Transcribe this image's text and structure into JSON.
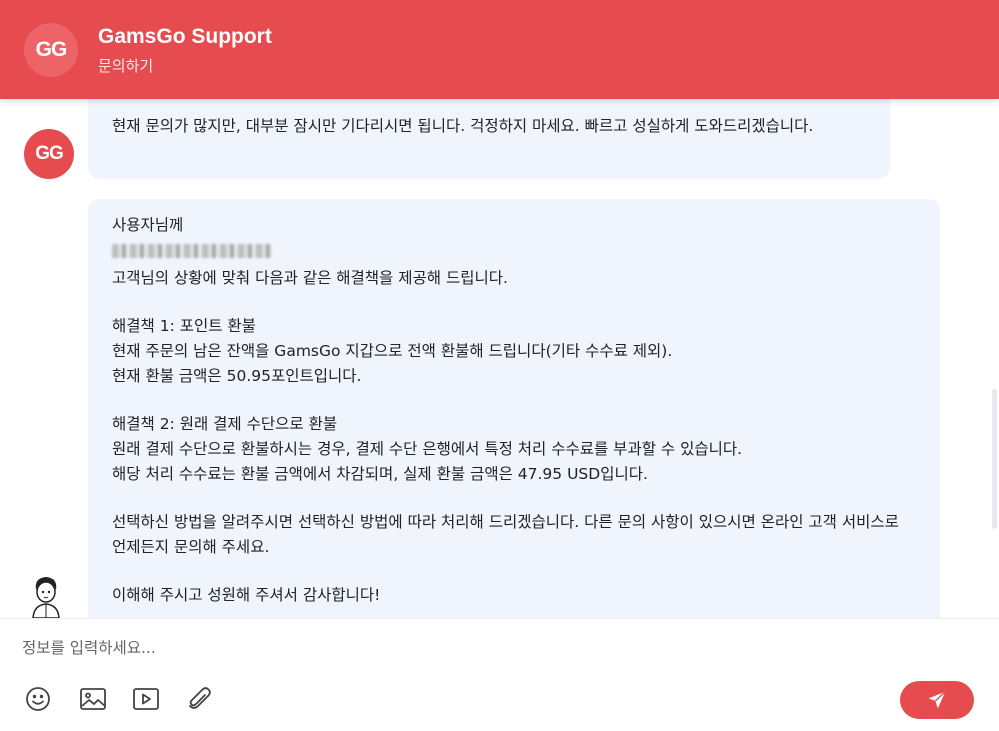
{
  "header": {
    "logo_text": "GG",
    "title": "GamsGo Support",
    "subtitle": "문의하기"
  },
  "messages": {
    "agent_avatar_text": "GG",
    "first": "현재 문의가 많지만, 대부분 잠시만 기다리시면 됩니다. 걱정하지 마세요. 빠르고 성실하게 도와드리겠습니다.",
    "second": {
      "greeting": "사용자님께",
      "line1": "고객님의 상황에 맞춰 다음과 같은 해결책을 제공해 드립니다.",
      "sol1_title": "해결책 1: 포인트 환불",
      "sol1_line1": "현재 주문의 남은 잔액을 GamsGo 지갑으로 전액 환불해 드립니다(기타 수수료 제외).",
      "sol1_line2": "현재 환불 금액은 50.95포인트입니다.",
      "sol2_title": "해결책 2: 원래 결제 수단으로 환불",
      "sol2_line1": "원래 결제 수단으로 환불하시는 경우, 결제 수단 은행에서 특정 처리 수수료를 부과할 수 있습니다.",
      "sol2_line2": "해당 처리 수수료는 환불 금액에서 차감되며, 실제 환불 금액은 47.95 USD입니다.",
      "closing1": "선택하신 방법을 알려주시면 선택하신 방법에 따라 처리해 드리겠습니다. 다른 문의 사항이 있으시면 온라인 고객 서비스로 언제든지 문의해 주세요.",
      "closing2": "이해해 주시고 성원해 주셔서 감사합니다!"
    }
  },
  "composer": {
    "placeholder": "정보를 입력하세요...",
    "tools": [
      "emoji-icon",
      "image-icon",
      "video-icon",
      "attachment-icon"
    ],
    "send_icon": "send-icon"
  },
  "colors": {
    "brand": "#e54b4f",
    "bubble": "#f0f5fd"
  }
}
